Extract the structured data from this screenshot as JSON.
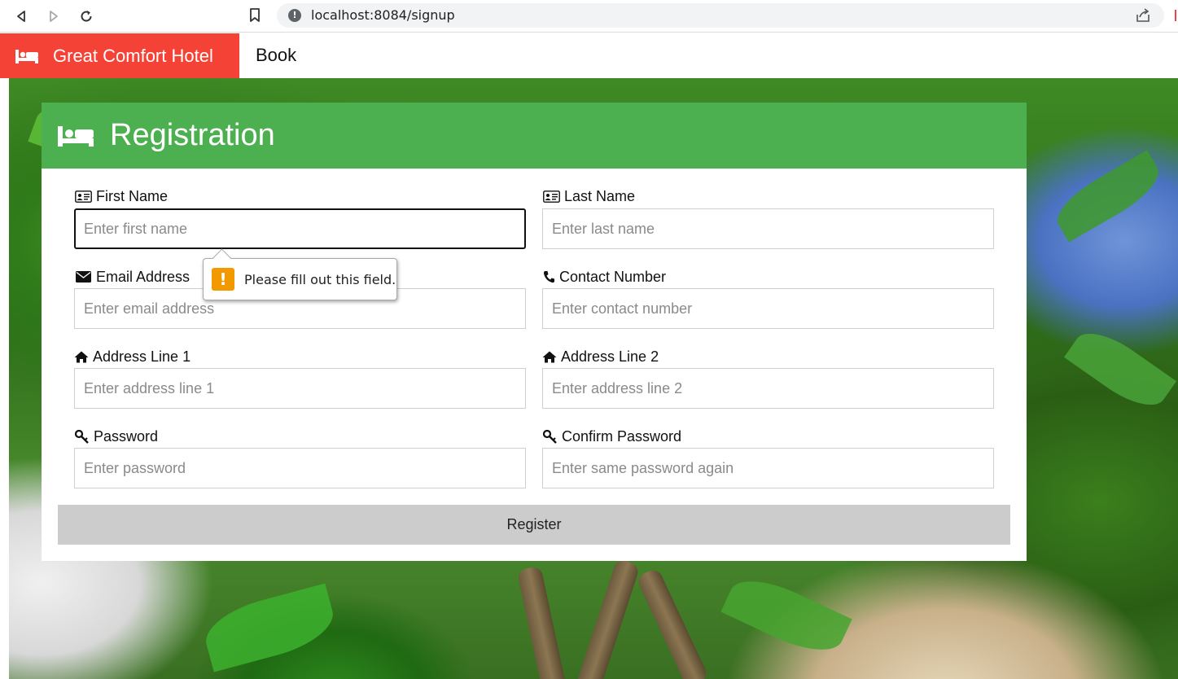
{
  "browser": {
    "url": "localhost:8084/signup"
  },
  "navbar": {
    "brand": "Great Comfort Hotel",
    "book_link": "Book",
    "brand_color": "#f44336"
  },
  "form": {
    "title": "Registration",
    "header_color": "#4caf50",
    "fields": [
      {
        "label": "First Name",
        "placeholder": "Enter first name",
        "icon": "id-card-icon",
        "focused": true
      },
      {
        "label": "Last Name",
        "placeholder": "Enter last name",
        "icon": "id-card-icon"
      },
      {
        "label": "Email Address",
        "placeholder": "Enter email address",
        "icon": "envelope-icon"
      },
      {
        "label": "Contact Number",
        "placeholder": "Enter contact number",
        "icon": "phone-icon"
      },
      {
        "label": "Address Line 1",
        "placeholder": "Enter address line 1",
        "icon": "home-icon"
      },
      {
        "label": "Address Line 2",
        "placeholder": "Enter address line 2",
        "icon": "home-icon"
      },
      {
        "label": "Password",
        "placeholder": "Enter password",
        "icon": "key-icon"
      },
      {
        "label": "Confirm Password",
        "placeholder": "Enter same password again",
        "icon": "key-icon"
      }
    ],
    "submit_label": "Register"
  },
  "validation": {
    "message": "Please fill out this field.",
    "icon": "warning-icon",
    "color": "#f29900"
  }
}
